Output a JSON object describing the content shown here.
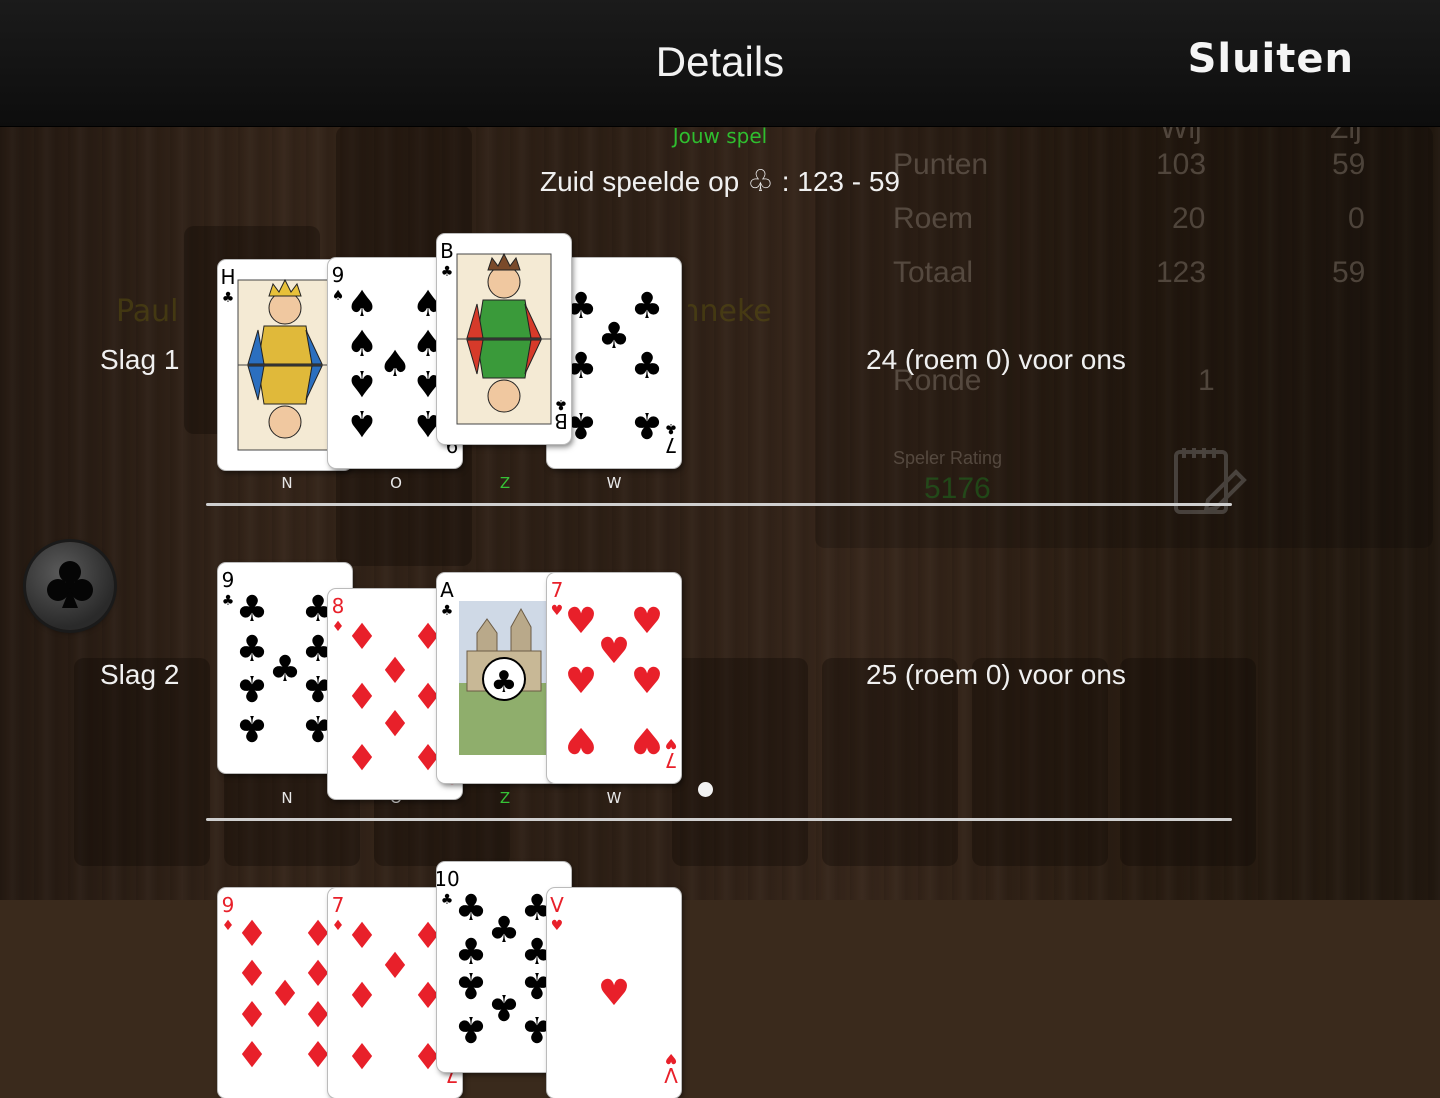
{
  "header": {
    "title": "Details",
    "close_label": "Sluiten"
  },
  "game_mode": "Jouw spel",
  "summary": {
    "prefix": "Zuid speelde op",
    "trump_suit_symbol": "♧",
    "score_text": ": 123 - 59"
  },
  "background_scoreboard": {
    "header_left": "Wij",
    "header_right": "Zij",
    "rows": [
      {
        "label": "Punten",
        "left": "103",
        "right": "59"
      },
      {
        "label": "Roem",
        "left": "20",
        "right": "0"
      },
      {
        "label": "Totaal",
        "left": "123",
        "right": "59"
      },
      {
        "label": "Ronde",
        "left": "1",
        "right": ""
      }
    ],
    "rating_label": "Speler Rating",
    "rating_value": "5176",
    "player_left": "Paul",
    "player_right": "Anneke"
  },
  "tricks": [
    {
      "label": "Slag 1",
      "result": "24 (roem 0) voor ons",
      "cards": [
        {
          "seat": "N",
          "rank": "H",
          "suit": "clubs",
          "suit_symbol": "♣",
          "color": "#000000",
          "kind": "king"
        },
        {
          "seat": "O",
          "rank": "9",
          "suit": "spades",
          "suit_symbol": "♠",
          "color": "#000000",
          "kind": "pip"
        },
        {
          "seat": "Z",
          "rank": "B",
          "suit": "clubs",
          "suit_symbol": "♣",
          "color": "#000000",
          "kind": "jack"
        },
        {
          "seat": "W",
          "rank": "7",
          "suit": "clubs",
          "suit_symbol": "♣",
          "color": "#000000",
          "kind": "pip"
        }
      ]
    },
    {
      "label": "Slag 2",
      "result": "25 (roem 0) voor ons",
      "cards": [
        {
          "seat": "N",
          "rank": "9",
          "suit": "clubs",
          "suit_symbol": "♣",
          "color": "#000000",
          "kind": "pip"
        },
        {
          "seat": "O",
          "rank": "8",
          "suit": "diamonds",
          "suit_symbol": "♦",
          "color": "#e8202a",
          "kind": "pip"
        },
        {
          "seat": "Z",
          "rank": "A",
          "suit": "clubs",
          "suit_symbol": "♣",
          "color": "#000000",
          "kind": "ace"
        },
        {
          "seat": "W",
          "rank": "7",
          "suit": "hearts",
          "suit_symbol": "♥",
          "color": "#e8202a",
          "kind": "pip"
        }
      ]
    },
    {
      "label": "",
      "result": "",
      "cards": [
        {
          "seat": "N",
          "rank": "9",
          "suit": "diamonds",
          "suit_symbol": "♦",
          "color": "#e8202a",
          "kind": "pip"
        },
        {
          "seat": "O",
          "rank": "7",
          "suit": "diamonds",
          "suit_symbol": "♦",
          "color": "#e8202a",
          "kind": "pip"
        },
        {
          "seat": "Z",
          "rank": "10",
          "suit": "clubs",
          "suit_symbol": "♣",
          "color": "#000000",
          "kind": "pip"
        },
        {
          "seat": "W",
          "rank": "V",
          "suit": "hearts",
          "suit_symbol": "♥",
          "color": "#e8202a",
          "kind": "pip"
        }
      ]
    }
  ],
  "colors": {
    "my_seat": "#36c236",
    "game_mode": "#2fbe2f",
    "red_suit": "#e8202a",
    "black_suit": "#000000"
  },
  "trump_button": {
    "symbol": "♣",
    "icon": "clubs-icon"
  },
  "icons": {
    "notes": "notepad-pencil-icon"
  }
}
